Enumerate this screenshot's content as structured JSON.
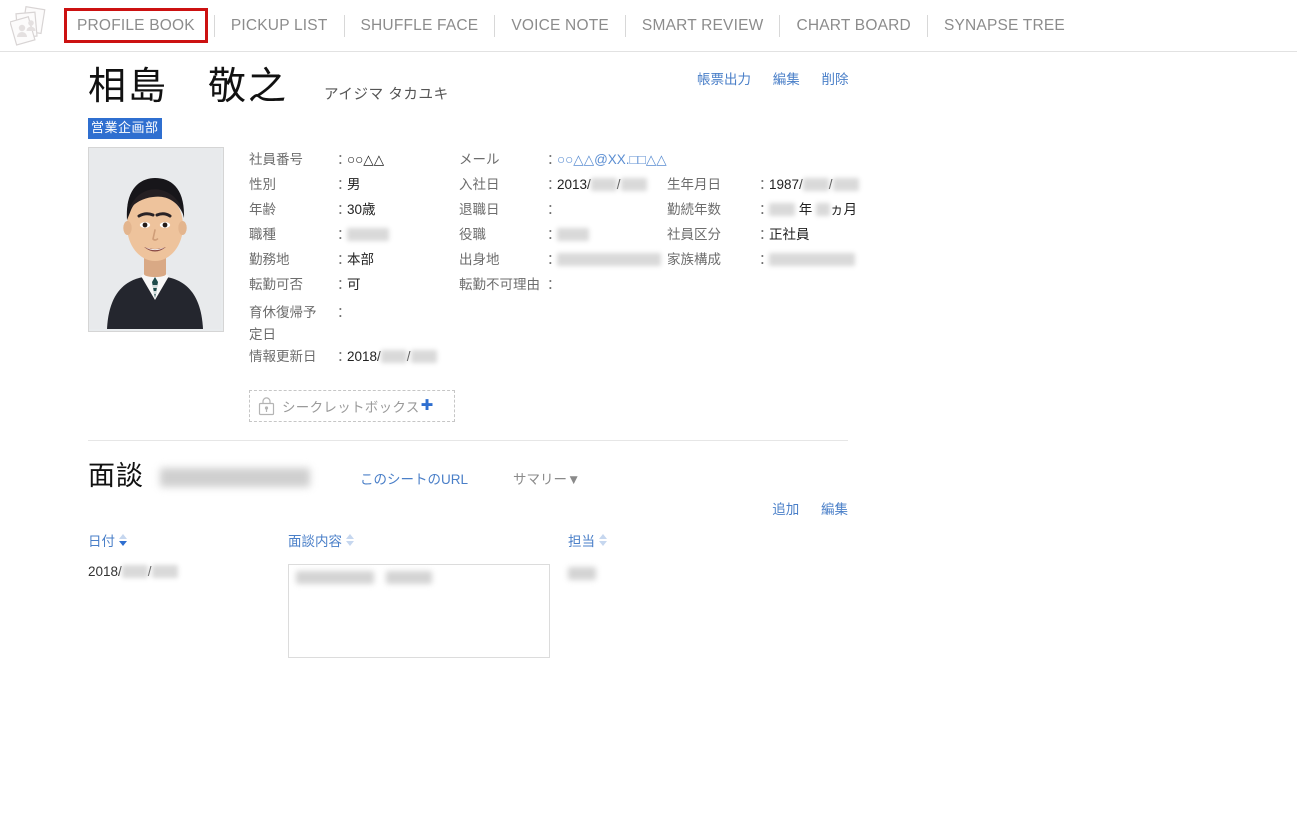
{
  "nav": {
    "logo_icon": "photo-stack-icon",
    "items": [
      {
        "label": "PROFILE BOOK",
        "active": true
      },
      {
        "label": "PICKUP LIST",
        "active": false
      },
      {
        "label": "SHUFFLE FACE",
        "active": false
      },
      {
        "label": "VOICE NOTE",
        "active": false
      },
      {
        "label": "SMART REVIEW",
        "active": false
      },
      {
        "label": "CHART BOARD",
        "active": false
      },
      {
        "label": "SYNAPSE TREE",
        "active": false
      }
    ],
    "active_highlight_color": "#cc1111"
  },
  "profile": {
    "name": "相島　敬之",
    "name_kana": "アイジマ タカユキ",
    "department": "営業企画部",
    "actions": [
      {
        "label": "帳票出力"
      },
      {
        "label": "編集"
      },
      {
        "label": "削除"
      }
    ],
    "fields": {
      "employee_no": {
        "label": "社員番号",
        "value": "○○△△"
      },
      "gender": {
        "label": "性別",
        "value": "男"
      },
      "age": {
        "label": "年齢",
        "value": "30歳"
      },
      "job_type": {
        "label": "職種",
        "value": ""
      },
      "work_location": {
        "label": "勤務地",
        "value": "本部"
      },
      "relocatable": {
        "label": "転勤可否",
        "value": "可"
      },
      "mail": {
        "label": "メール",
        "value": "○○△△@XX.□□△△"
      },
      "join_date": {
        "label": "入社日",
        "value": "2013/"
      },
      "leave_date": {
        "label": "退職日",
        "value": ""
      },
      "position": {
        "label": "役職",
        "value": ""
      },
      "birthplace": {
        "label": "出身地",
        "value": ""
      },
      "relocation_reason": {
        "label": "転勤不可理由",
        "value": ""
      },
      "birthday": {
        "label": "生年月日",
        "value": "1987/"
      },
      "years_of_service": {
        "label": "勤続年数",
        "unit_year": "年",
        "unit_month": "ヵ月"
      },
      "employee_class": {
        "label": "社員区分",
        "value": "正社員"
      },
      "family": {
        "label": "家族構成",
        "value": ""
      },
      "childcare_return": {
        "label": "育休復帰予",
        "label2": "定日",
        "value": ""
      },
      "updated": {
        "label": "情報更新日",
        "value": "2018/"
      }
    },
    "secret_box": {
      "label": "シークレットボックス",
      "icon": "lock-icon",
      "plus": "✚"
    }
  },
  "meeting": {
    "title": "面談",
    "sheet_url_label": "このシートのURL",
    "summary_label": "サマリー▼",
    "add_label": "追加",
    "edit_label": "編集",
    "columns": [
      {
        "label": "日付",
        "sort": "desc"
      },
      {
        "label": "面談内容",
        "sort": "none"
      },
      {
        "label": "担当",
        "sort": "none"
      }
    ],
    "rows": [
      {
        "date": "2018/",
        "content": "",
        "owner": ""
      }
    ]
  },
  "colors": {
    "link": "#4a7fc8",
    "accent_red": "#cc1111",
    "tag_blue": "#2f6fd0",
    "text": "#333333",
    "muted": "#6d6d6d"
  }
}
